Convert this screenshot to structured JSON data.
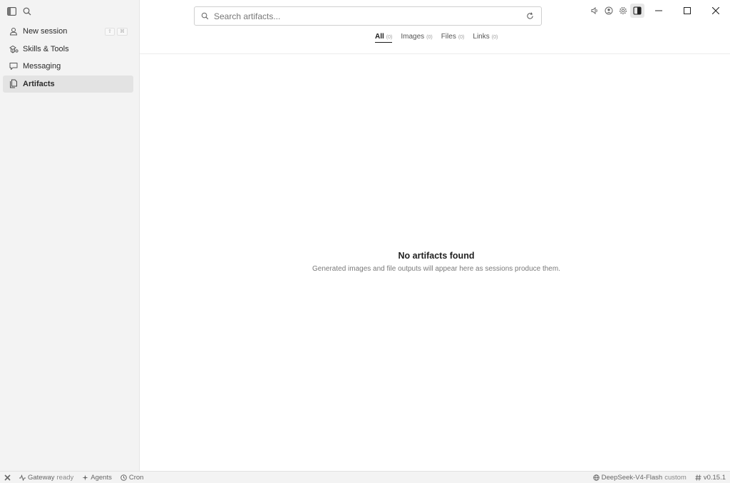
{
  "sidebar": {
    "items": [
      {
        "label": "New session",
        "shortcuts": [
          "⇧",
          "⌘"
        ]
      },
      {
        "label": "Skills & Tools"
      },
      {
        "label": "Messaging"
      },
      {
        "label": "Artifacts"
      }
    ]
  },
  "search": {
    "placeholder": "Search artifacts..."
  },
  "tabs": [
    {
      "label": "All",
      "count": "(0)"
    },
    {
      "label": "Images",
      "count": "(0)"
    },
    {
      "label": "Files",
      "count": "(0)"
    },
    {
      "label": "Links",
      "count": "(0)"
    }
  ],
  "empty": {
    "title": "No artifacts found",
    "description": "Generated images and file outputs will appear here as sessions produce them."
  },
  "status": {
    "gateway_label": "Gateway",
    "gateway_state": "ready",
    "agents_label": "Agents",
    "cron_label": "Cron",
    "model_name": "DeepSeek-V4-Flash",
    "model_tag": "custom",
    "version": "v0.15.1"
  }
}
